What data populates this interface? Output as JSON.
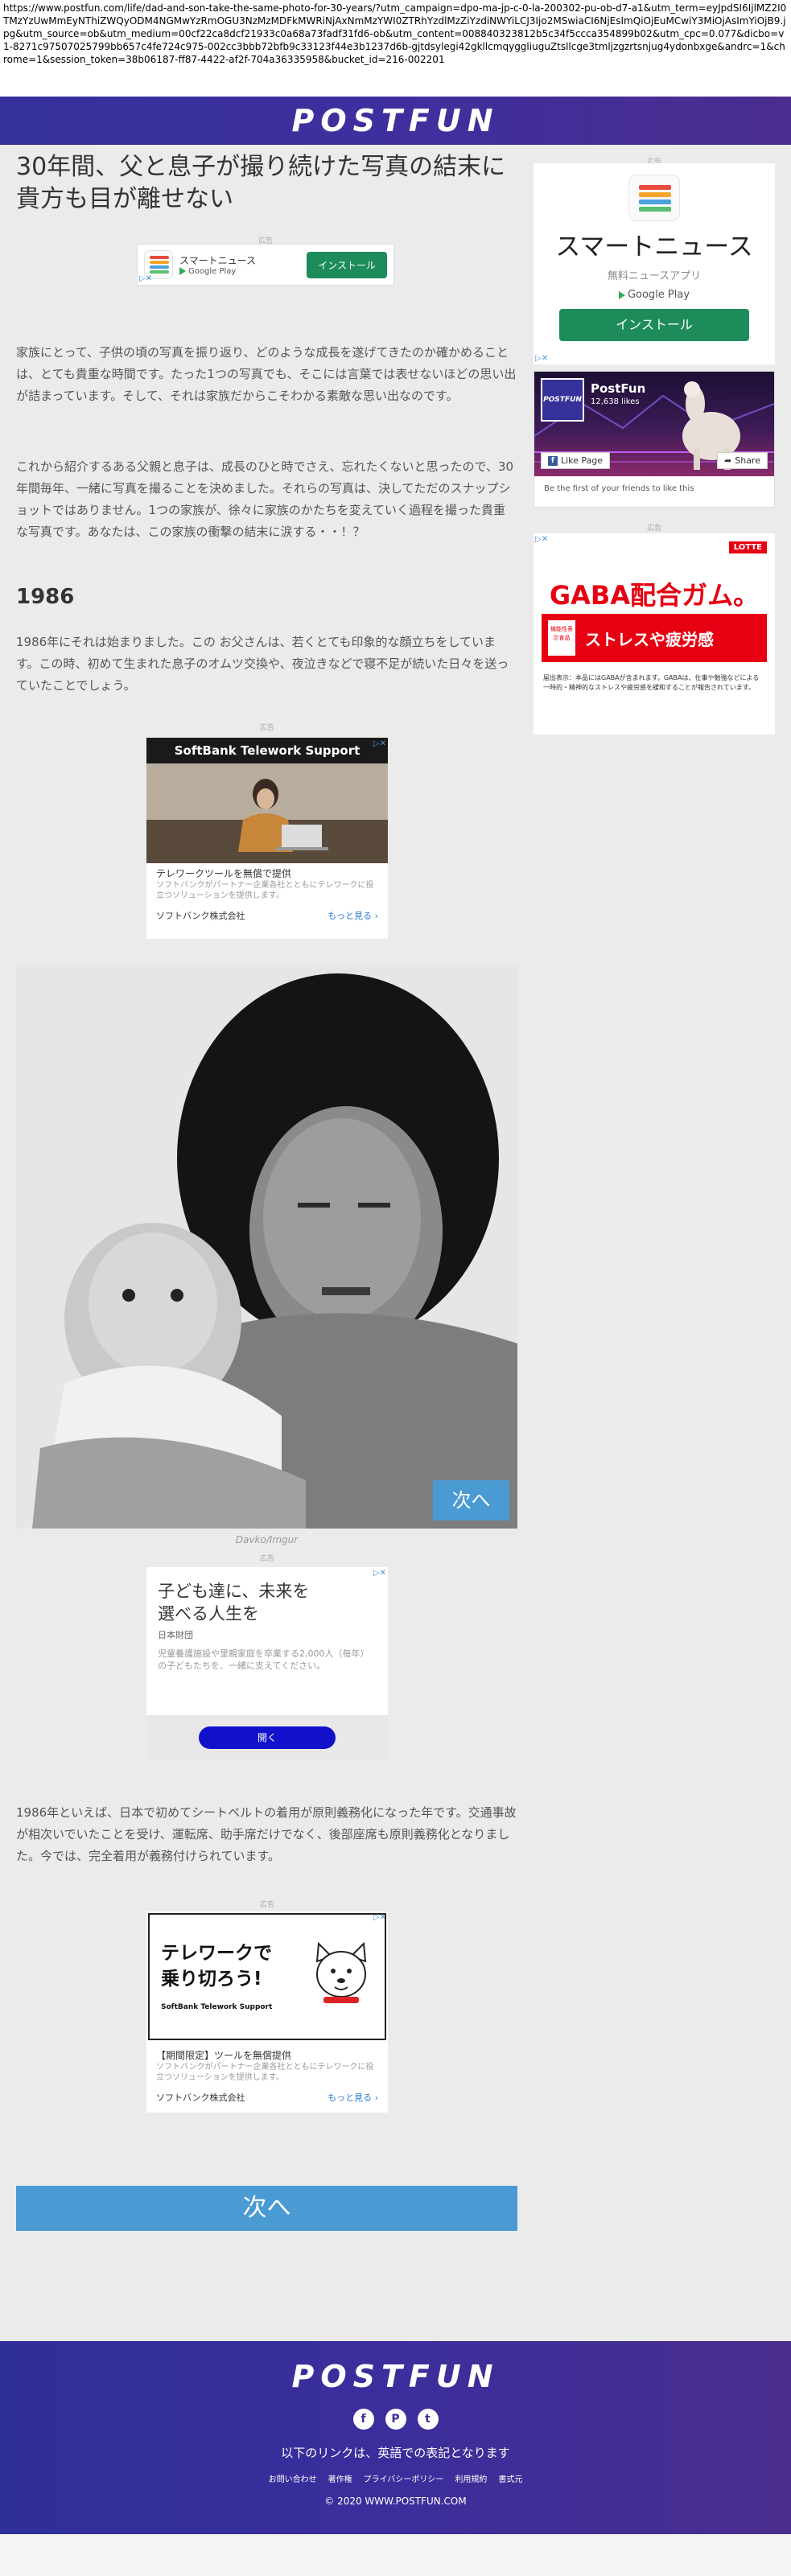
{
  "browser": {
    "url": "https://www.postfun.com/life/dad-and-son-take-the-same-photo-for-30-years/?utm_campaign=dpo-ma-jp-c-0-la-200302-pu-ob-d7-a1&utm_term=eyJpdSI6IjlMZ2I0TMzYzUwMmEyNThiZWQyODM4NGMwYzRmOGU3NzMzMDFkMWRiNjAxNmMzYWI0ZTRhYzdlMzZiYzdiNWYiLCJ3Ijo2MSwiaCI6NjEsImQiOjEuMCwiY3MiOjAsImYiOjB9.jpg&utm_source=ob&utm_medium=00cf22ca8dcf21933c0a68a73fadf31fd6-ob&utm_content=008840323812b5c34f5ccca354899b02&utm_cpc=0.077&dicbo=v1-8271c97507025799bb657c4fe724c975-002cc3bbb72bfb9c33123f44e3b1237d6b-gjtdsylegi42gkllcmqyggliuguZtsllcge3tmljzgzrtsnjug4ydonbxge&andrc=1&chrome=1&session_token=38b06187-ff87-4422-af2f-704a36335958&bucket_id=216-002201"
  },
  "header": {
    "logo": "POSTFUN"
  },
  "article": {
    "title": "30年間、父と息子が撮り続けた写真の結末に貴方も目が離せない",
    "intro_1": "家族にとって、子供の頃の写真を振り返り、どのような成長を遂げてきたのか確かめることは、とても貴重な時間です。たった1つの写真でも、そこには言葉では表せないほどの思い出が詰まっています。そして、それは家族だからこそわかる素敵な思い出なのです。",
    "intro_2": "これから紹介するある父親と息子は、成長のひと時でさえ、忘れたくないと思ったので、30年間毎年、一緒に写真を撮ることを決めました。それらの写真は、決してただのスナップショットではありません。1つの家族が、徐々に家族のかたちを変えていく過程を撮った貴重な写真です。あなたは、この家族の衝撃の結末に涙する・・！？",
    "heading": "1986",
    "para_1986": "1986年にそれは始まりました。この お父さんは、若くとても印象的な顔立ちをしています。この時、初めて生まれた息子のオムツ交換や、夜泣きなどで寝不足が続いた日々を送っていたことでしょう。",
    "photo_credit": "Davko/Imgur",
    "next_small": "次へ",
    "para_seatbelt": "1986年といえば、日本で初めてシートベルトの着用が原則義務化になった年です。交通事故が相次いでいたことを受け、運転席、助手席だけでなく、後部座席も原則義務化となりました。今では、完全着用が義務付けられています。",
    "next_big": "次へ"
  },
  "ads": {
    "label": "広告",
    "small_app": {
      "name": "スマートニュース",
      "store": "Google Play",
      "button": "インストール"
    },
    "softbank_1": {
      "title": "SoftBank Telework Support",
      "headline": "テレワークツールを無償で提供",
      "sub": "ソフトバンクがパートナー企業各社とともにテレワークに役立つソリューションを提供します。",
      "advertiser": "ソフトバンク株式会社",
      "more": "もっと見る"
    },
    "nippon": {
      "headline_1": "子ども達に、未来を",
      "headline_2": "選べる人生を",
      "org": "日本財団",
      "body": "児童養護施設や里親家庭を卒業する2,000人（毎年）の子どもたちを、一緒に支えてください。",
      "button": "開く"
    },
    "softbank_2": {
      "headline_1": "テレワークで",
      "headline_2": "乗り切ろう!",
      "brand": "SoftBank Telework Support",
      "title": "【期間限定】ツールを無償提供",
      "sub": "ソフトバンクがパートナー企業各社とともにテレワークに役立つソリューションを提供します。",
      "advertiser": "ソフトバンク株式会社",
      "more": "もっと見る"
    },
    "sidebar_app": {
      "title": "スマートニュース",
      "sub": "無料ニュースアプリ",
      "store": "Google Play",
      "button": "インストール"
    },
    "gaba": {
      "brand": "LOTTE",
      "title": "GABA配合ガム。",
      "tag": "機能性表示食品",
      "stress": "ストレスや疲労感",
      "note": "届出表示：本品にはGABAが含まれます。GABAは、仕事や勉強などによる一時的・精神的なストレスや疲労感を緩和することが報告されています。"
    }
  },
  "facebook": {
    "page_name": "PostFun",
    "likes": "12,638 likes",
    "like_btn": "Like Page",
    "share_btn": "Share",
    "prompt": "Be the first of your friends to like this"
  },
  "footer": {
    "logo": "POSTFUN",
    "social": [
      "f",
      "P",
      "t"
    ],
    "note": "以下のリンクは、英語での表記となります",
    "links": [
      "お問い合わせ",
      "著作権",
      "プライバシーポリシー",
      "利用規約",
      "書式元"
    ],
    "copyright": "© 2020 WWW.POSTFUN.COM"
  }
}
